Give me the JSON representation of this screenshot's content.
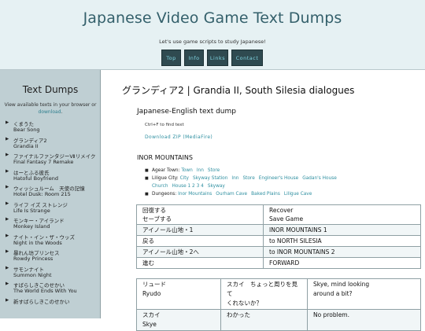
{
  "header": {
    "title": "Japanese Video Game Text Dumps",
    "tagline": "Let's use game scripts to study Japanese!",
    "nav": [
      "Top",
      "Info",
      "Links",
      "Contact"
    ]
  },
  "sidebar": {
    "title": "Text Dumps",
    "desc_line1": "View available texts in your browser or",
    "desc_link": "download",
    "desc_end": ".",
    "items": [
      {
        "jp": "くまうた",
        "en": "Bear Song"
      },
      {
        "jp": "グランディア2",
        "en": "Grandia II"
      },
      {
        "jp": "ファイナルファンタジーⅦリメイク",
        "en": "Final Fantasy 7 Remake"
      },
      {
        "jp": "はーとふる彼氏",
        "en": "Hatoful Boyfriend"
      },
      {
        "jp": "ウィッシュルーム　天使の記憶",
        "en": "Hotel Dusk: Room 215"
      },
      {
        "jp": "ライフ イズ ストレンジ",
        "en": "Life Is Strange"
      },
      {
        "jp": "モンキー・アイランド",
        "en": "Monkey Island"
      },
      {
        "jp": "ナイト・イン・ザ・ウッズ",
        "en": "Night in the Woods"
      },
      {
        "jp": "暴れん坊プリンセス",
        "en": "Rowdy Princess"
      },
      {
        "jp": "サモンナイト",
        "en": "Summon Night"
      },
      {
        "jp": "すばらしきこのせかい",
        "en": "The World Ends With You"
      },
      {
        "jp": "新すばらしきこのせかい",
        "en": ""
      }
    ]
  },
  "main": {
    "title": "グランディア2 | Grandia II, South Silesia dialogues",
    "section_title": "Japanese-English text dump",
    "hint": "Ctrl+F to find text",
    "download": "Download ZIP (MediaFire)",
    "location_title": "INOR MOUNTAINS",
    "locations": [
      {
        "label": "Agear Town:",
        "links": [
          "Town",
          "Inn",
          "Store"
        ]
      },
      {
        "label": "Liligue City:",
        "links": [
          "City",
          "Skyway Station",
          "Inn",
          "Store",
          "Engineer's House",
          "Gadan's House",
          "Church",
          "House 1 2 3 4",
          "Skyway"
        ]
      },
      {
        "label": "Dungeons:",
        "links": [
          "Inor Mountains",
          "Ourham Cave",
          "Baked Plains",
          "Liligue Cave"
        ]
      }
    ],
    "table1": [
      [
        "回復する\nセーブする",
        "Recover\nSave Game"
      ],
      [
        "アイノール山地・1",
        "INOR MOUNTAINS 1"
      ],
      [
        "戻る",
        "to NORTH SILESIA"
      ],
      [
        "アイノール山地・2へ",
        "to INOR MOUNTAINS 2"
      ],
      [
        "進む",
        "FORWARD"
      ]
    ],
    "table2": [
      [
        "リュード\nRyudo",
        "スカイ　ちょっと周りを見て\nくれないか？",
        "Skye, mind looking\naround a bit?"
      ],
      [
        "スカイ\nSkye",
        "わかった",
        "No problem."
      ]
    ]
  }
}
